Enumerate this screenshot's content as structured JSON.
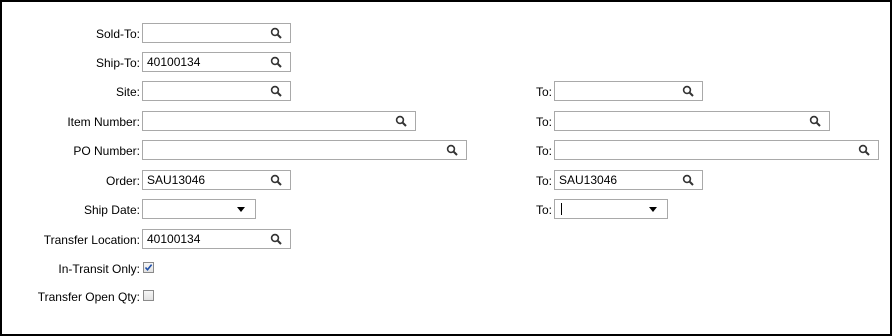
{
  "form": {
    "sold_to": {
      "label": "Sold-To:",
      "value": ""
    },
    "ship_to": {
      "label": "Ship-To:",
      "value": "40100134"
    },
    "site": {
      "label": "Site:",
      "value": "",
      "to_label": "To:",
      "to_value": ""
    },
    "item_number": {
      "label": "Item Number:",
      "value": "",
      "to_label": "To:",
      "to_value": ""
    },
    "po_number": {
      "label": "PO Number:",
      "value": "",
      "to_label": "To:",
      "to_value": ""
    },
    "order": {
      "label": "Order:",
      "value": "SAU13046",
      "to_label": "To:",
      "to_value": "SAU13046"
    },
    "ship_date": {
      "label": "Ship Date:",
      "value": "",
      "to_label": "To:",
      "to_value": ""
    },
    "transfer_location": {
      "label": "Transfer Location:",
      "value": "40100134"
    },
    "in_transit_only": {
      "label": "In-Transit Only:",
      "checked": true
    },
    "transfer_open_qty": {
      "label": "Transfer Open Qty:",
      "checked": false
    }
  },
  "icons": {
    "lookup": "search-icon",
    "dropdown": "chevron-down-icon"
  }
}
